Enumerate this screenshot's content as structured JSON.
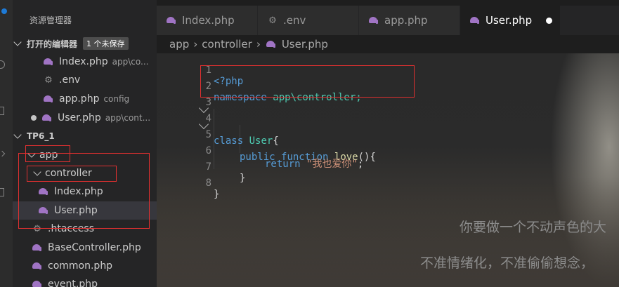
{
  "sidebar": {
    "title": "资源管理器",
    "open_editors": {
      "label": "打开的编辑器",
      "badge": "1 个未保存",
      "items": [
        {
          "name": "Index.php",
          "hint": "app\\co...",
          "icon": "php-elephant-icon"
        },
        {
          "name": ".env",
          "hint": "",
          "icon": "gear-icon"
        },
        {
          "name": "app.php",
          "hint": "config",
          "icon": "php-elephant-icon"
        },
        {
          "name": "User.php",
          "hint": "app\\cont...",
          "icon": "php-elephant-icon",
          "unsaved": true
        }
      ]
    },
    "project": {
      "label": "TP6_1",
      "tree": [
        {
          "name": "app",
          "type": "folder"
        },
        {
          "name": "controller",
          "type": "folder"
        },
        {
          "name": "Index.php",
          "type": "php"
        },
        {
          "name": "User.php",
          "type": "php",
          "selected": true
        },
        {
          "name": ".htaccess",
          "type": "config"
        },
        {
          "name": "BaseController.php",
          "type": "php"
        },
        {
          "name": "common.php",
          "type": "php"
        },
        {
          "name": "event.php",
          "type": "php"
        }
      ]
    }
  },
  "tabs": [
    {
      "label": "Index.php",
      "icon": "php-elephant-icon"
    },
    {
      "label": ".env",
      "icon": "gear-icon"
    },
    {
      "label": "app.php",
      "icon": "php-elephant-icon"
    },
    {
      "label": "User.php",
      "icon": "php-elephant-icon",
      "active": true,
      "unsaved": true
    }
  ],
  "breadcrumb": [
    "app",
    "controller",
    "User.php"
  ],
  "code": {
    "line_numbers": [
      "1",
      "2",
      "3",
      "4",
      "5",
      "6",
      "7",
      "8"
    ],
    "l1": "<?php",
    "l2_kw": "namespace",
    "l2_rest": " app\\controller;",
    "l4_kw": "class",
    "l4_cls": "User",
    "l4_rest": "{",
    "l5_kw1": "public",
    "l5_kw2": "function",
    "l5_fn": "love",
    "l5_rest": "(){",
    "l6_kw": "return",
    "l6_str": "\"我也爱你\"",
    "l6_rest": ";",
    "l7": "}",
    "l8": "}"
  },
  "background_text": {
    "line1": "你要做一个不动声色的大",
    "line2": "不准情绪化，不准偷偷想念，"
  },
  "colors": {
    "accent_highlight": "#e03030",
    "php_icon": "#a074c4"
  }
}
